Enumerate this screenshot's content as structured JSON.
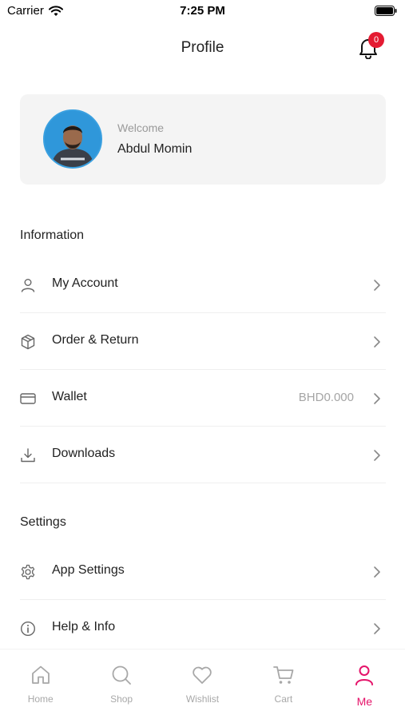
{
  "status_bar": {
    "carrier": "Carrier",
    "time": "7:25 PM"
  },
  "header": {
    "title": "Profile",
    "notification_count": "0"
  },
  "profile": {
    "welcome": "Welcome",
    "name": "Abdul Momin"
  },
  "sections": {
    "information": {
      "title": "Information",
      "items": [
        {
          "label": "My Account",
          "icon": "user-icon"
        },
        {
          "label": "Order & Return",
          "icon": "box-icon"
        },
        {
          "label": "Wallet",
          "icon": "card-icon",
          "value": "BHD0.000"
        },
        {
          "label": "Downloads",
          "icon": "download-icon"
        }
      ]
    },
    "settings": {
      "title": "Settings",
      "items": [
        {
          "label": "App Settings",
          "icon": "gear-icon"
        },
        {
          "label": "Help & Info",
          "icon": "info-icon"
        }
      ]
    }
  },
  "tabs": [
    {
      "label": "Home",
      "icon": "home-icon",
      "active": false
    },
    {
      "label": "Shop",
      "icon": "search-icon",
      "active": false
    },
    {
      "label": "Wishlist",
      "icon": "heart-icon",
      "active": false
    },
    {
      "label": "Cart",
      "icon": "cart-icon",
      "active": false
    },
    {
      "label": "Me",
      "icon": "person-icon",
      "active": true
    }
  ],
  "colors": {
    "accent": "#e5146a",
    "badge": "#e41b32",
    "card_bg": "#f4f4f4",
    "muted": "#a8a8a8"
  }
}
